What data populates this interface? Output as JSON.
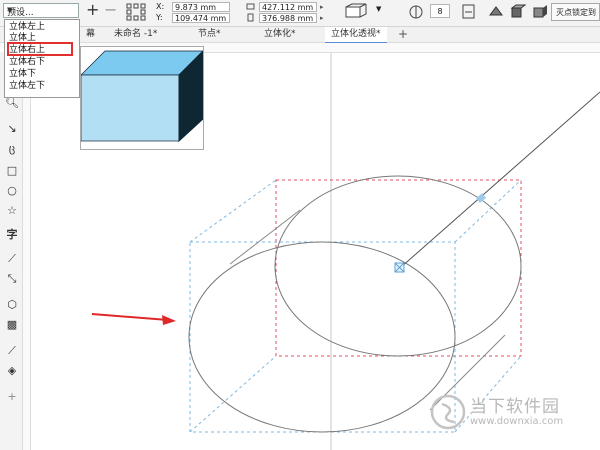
{
  "toolbar": {
    "preset_label": "预设...",
    "x_label": "X:",
    "y_label": "Y:",
    "x_value": "9.873 mm",
    "y_value": "109.474 mm",
    "width_value": "427.112 mm",
    "height_value": "376.988 mm",
    "depth_value": "8",
    "vanishing_point_label": "灭点锁定到"
  },
  "preset_dropdown": {
    "items": [
      "立体左上",
      "立体上",
      "立体右上",
      "立体右下",
      "立体下",
      "立体左下"
    ],
    "selected": "立体右上"
  },
  "tabs": [
    {
      "label": "未命名 -1*"
    },
    {
      "label": "节点*"
    },
    {
      "label": "立体化*"
    },
    {
      "label": "立体化透视*",
      "active": true
    }
  ],
  "tab_partial": "幕",
  "watermark": {
    "title": "当下软件园",
    "url": "www.downxia.com"
  },
  "colors": {
    "cube_front": "#b3dff4",
    "cube_top": "#7ccaf0",
    "cube_side": "#0f2733",
    "red_guides": "#e05060",
    "blue_guides": "#7fb8e0",
    "arrow": "#e02828"
  }
}
